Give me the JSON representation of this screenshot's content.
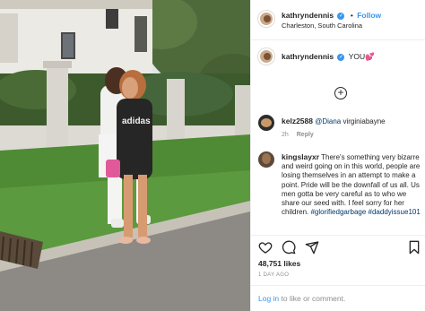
{
  "header": {
    "username": "kathryndennis",
    "separator": "•",
    "follow_label": "Follow",
    "location": "Charleston, South Carolina"
  },
  "caption": {
    "username": "kathryndennis",
    "text": "YOU💕"
  },
  "load_more_label": "+",
  "comments": [
    {
      "username": "kelz2588",
      "mention": "@Diana",
      "text": "virginiabayne",
      "time": "2h",
      "reply_label": "Reply"
    },
    {
      "username": "kingslayxr",
      "text": "There's something very bizarre and weird going on in this world, people are losing themselves in an attempt to make a point. Pride will be the downfall of us all. Us men gotta be very careful as to who we share our seed with. I feel sorry for her children.",
      "tags": "#glorifiedgarbage #daddyissue101"
    }
  ],
  "likes": "48,751 likes",
  "time_ago": "1 DAY AGO",
  "login": {
    "link_label": "Log in",
    "rest": "to like or comment."
  },
  "colors": {
    "link_blue": "#3897f0",
    "verified_blue": "#3897f0",
    "mention_color": "#00376b",
    "muted_gray": "#8e8e8e"
  },
  "icons": [
    "verified-badge-icon",
    "add-circle-icon",
    "heart-icon",
    "comment-icon",
    "share-icon",
    "bookmark-icon"
  ]
}
